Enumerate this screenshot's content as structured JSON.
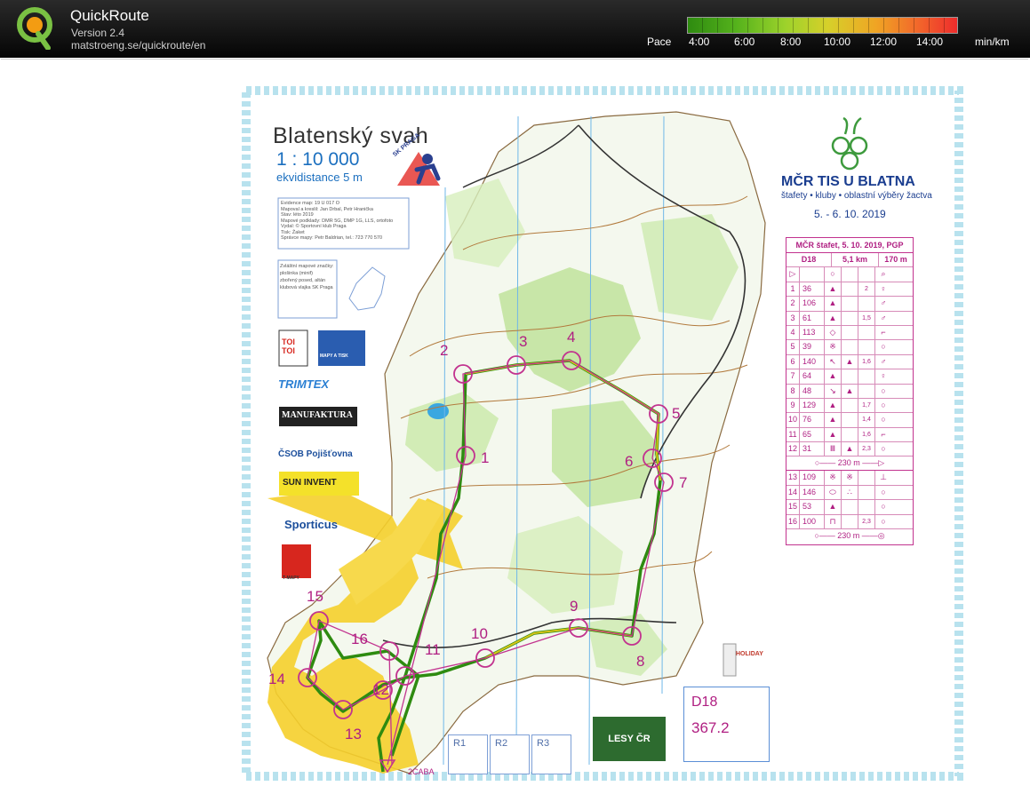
{
  "app": {
    "title": "QuickRoute",
    "version": "Version 2.4",
    "url": "matstroeng.se/quickroute/en"
  },
  "pace": {
    "label": "Pace",
    "ticks": [
      "4:00",
      "6:00",
      "8:00",
      "10:00",
      "12:00",
      "14:00"
    ],
    "unit": "min/km"
  },
  "map": {
    "name": "Blatenský svah",
    "scale": "1 : 10 000",
    "equidistance": "ekvidistance 5 m",
    "event_title": "MČR TIS U BLATNA",
    "event_subtitle": "štafety • kluby • oblastní výběry žactva",
    "event_dates": "5. - 6. 10. 2019",
    "club_logo_text": "SK PRAGA",
    "map_code": "2CABA"
  },
  "legend_info": {
    "lines": [
      "Evidence map: 19 U 017 O",
      "Mapoval a kreslil: Jan Drbal, Petr Hranička",
      "Stav: léto 2019",
      "Mapové podklady: DMR 5G, DMP 1G, LLS, ortofoto",
      "Vydal: © Sportovní klub Praga",
      "Tisk: Žaket",
      "Správce mapy: Petr Baldrian, tel.: 723 770 570"
    ],
    "special_title": "Zvláštní mapové značky:",
    "special_items": [
      "plošinka (minif)",
      "zbořený posed, altán",
      "klubová vlajka SK Praga"
    ]
  },
  "description_sheet": {
    "header": "MČR štafet, 5. 10. 2019, PGP",
    "course": "D18",
    "length": "5,1 km",
    "climb": "170 m",
    "rows": [
      {
        "n": "1",
        "code": "36",
        "dist": "2",
        "end": "♀"
      },
      {
        "n": "2",
        "code": "106",
        "dist": "",
        "end": "♂"
      },
      {
        "n": "3",
        "code": "61",
        "dist": "1,5",
        "end": "♂"
      },
      {
        "n": "4",
        "code": "113",
        "dist": "",
        "end": "⌐"
      },
      {
        "n": "5",
        "code": "39",
        "dist": "",
        "end": "○"
      },
      {
        "n": "6",
        "code": "140",
        "dist": "1,6",
        "end": "♂"
      },
      {
        "n": "7",
        "code": "64",
        "dist": "",
        "end": "♀"
      },
      {
        "n": "8",
        "code": "48",
        "dist": "",
        "end": "○"
      },
      {
        "n": "9",
        "code": "129",
        "dist": "1,7",
        "end": "○"
      },
      {
        "n": "10",
        "code": "76",
        "dist": "1,4",
        "end": "○"
      },
      {
        "n": "11",
        "code": "65",
        "dist": "1,6",
        "end": "⌐"
      },
      {
        "n": "12",
        "code": "31",
        "dist": "2,3",
        "end": "○"
      }
    ],
    "taped1": "230 m",
    "rows2": [
      {
        "n": "13",
        "code": "109",
        "dist": "",
        "end": "⊥"
      },
      {
        "n": "14",
        "code": "146",
        "dist": "",
        "end": "○"
      },
      {
        "n": "15",
        "code": "53",
        "dist": "",
        "end": "○"
      },
      {
        "n": "16",
        "code": "100",
        "dist": "2,3",
        "end": "○"
      }
    ],
    "taped2": "230 m"
  },
  "controls": [
    {
      "n": "1"
    },
    {
      "n": "2"
    },
    {
      "n": "3"
    },
    {
      "n": "4"
    },
    {
      "n": "5"
    },
    {
      "n": "6"
    },
    {
      "n": "7"
    },
    {
      "n": "8"
    },
    {
      "n": "9"
    },
    {
      "n": "10"
    },
    {
      "n": "11"
    },
    {
      "n": "12"
    },
    {
      "n": "13"
    },
    {
      "n": "14"
    },
    {
      "n": "15"
    },
    {
      "n": "16"
    }
  ],
  "sponsors": {
    "toitoi": "TOI TOI",
    "mapy": "MAPY A TISK",
    "trimtex": "TRIMTEX",
    "manufaktura": "MANUFAKTURA",
    "csob": "ČSOB Pojišťovna",
    "sun": "SUN INVENT",
    "sporticus": "Sporticus",
    "tmapy": "T-MAPY",
    "holiday": "HOLIDAY",
    "lesy": "LESY ČR"
  },
  "course_box": {
    "name": "D18",
    "length": "367.2"
  },
  "relay_boxes": [
    "R1",
    "R2",
    "R3"
  ]
}
